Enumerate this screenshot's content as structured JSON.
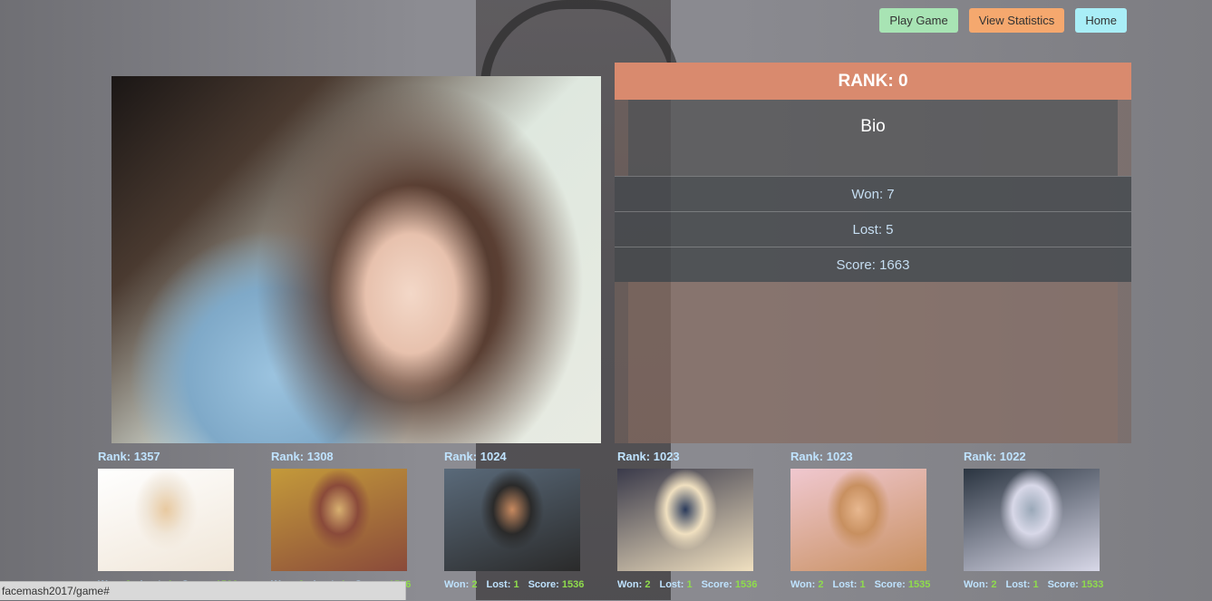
{
  "nav": {
    "play_label": "Play Game",
    "stats_label": "View Statistics",
    "home_label": "Home"
  },
  "panel": {
    "rank_label": "RANK: 0",
    "bio_title": "Bio",
    "won_label": "Won: 7",
    "lost_label": "Lost: 5",
    "score_label": "Score: 1663"
  },
  "thumbnails": [
    {
      "rank": "Rank: 1357",
      "won": "2",
      "lost": "1",
      "score": "1536",
      "colors": [
        "#ffffff",
        "#f0e6d8",
        "#e8c9a0"
      ]
    },
    {
      "rank": "Rank: 1308",
      "won": "2",
      "lost": "1",
      "score": "1536",
      "colors": [
        "#c49a3a",
        "#8a4a3a",
        "#d8b070"
      ]
    },
    {
      "rank": "Rank: 1024",
      "won": "2",
      "lost": "1",
      "score": "1536",
      "colors": [
        "#5a6a7a",
        "#2a2a2a",
        "#c88a60"
      ]
    },
    {
      "rank": "Rank: 1023",
      "won": "2",
      "lost": "1",
      "score": "1536",
      "colors": [
        "#3a3a4a",
        "#f0e0c0",
        "#2a3a5a"
      ]
    },
    {
      "rank": "Rank: 1023",
      "won": "2",
      "lost": "1",
      "score": "1535",
      "colors": [
        "#f0c8d0",
        "#c89060",
        "#e8b890"
      ]
    },
    {
      "rank": "Rank: 1022",
      "won": "2",
      "lost": "1",
      "score": "1533",
      "colors": [
        "#2a3440",
        "#d8d8e8",
        "#9aa8b8"
      ]
    }
  ],
  "stat_keys": {
    "won": "Won:",
    "lost": "Lost:",
    "score": "Score:"
  },
  "status_url": "facemash2017/game#",
  "colors": {
    "play_button": "#a8e4b4",
    "stats_button": "#f5a86e",
    "home_button": "#a9eef7",
    "rank_bar": "#d98a6e",
    "stat_value": "#8fdc4c",
    "rank_text": "#bfe3ff"
  }
}
